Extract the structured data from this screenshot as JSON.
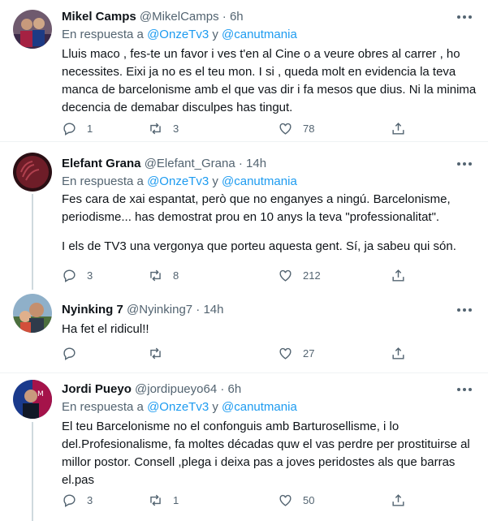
{
  "tweets": [
    {
      "name": "Mikel Camps",
      "handle": "@MikelCamps",
      "separator": "·",
      "time": "6h",
      "reply_prefix": "En respuesta a",
      "mention1": "@OnzeTv3",
      "conjunction": "y",
      "mention2": "@canutmania",
      "text": "Lluis maco , fes-te un favor i ves t'en al Cine o a veure obres al carrer , ho necessites. Eixi ja no es el teu mon. I si , queda molt en evidencia la teva manca de barcelonisme amb el que vas dir i fa mesos que dius. Ni la minima decencia de demabar disculpes has tingut.",
      "replies": "1",
      "retweets": "3",
      "likes": "78"
    },
    {
      "name": "Elefant Grana",
      "handle": "@Elefant_Grana",
      "separator": "·",
      "time": "14h",
      "reply_prefix": "En respuesta a",
      "mention1": "@OnzeTv3",
      "conjunction": "y",
      "mention2": "@canutmania",
      "text": "Fes cara de xai espantat, però que no enganyes a ningú. Barcelonisme, periodisme... has demostrat prou en 10 anys la teva \"professionalitat\".",
      "text2": "I els de TV3 una vergonya que porteu aquesta gent. Sí, ja sabeu qui són.",
      "replies": "3",
      "retweets": "8",
      "likes": "212"
    },
    {
      "name": "Nyinking 7",
      "handle": "@Nyinking7",
      "separator": "·",
      "time": "14h",
      "text": "Ha fet el ridicul!!",
      "replies": "",
      "retweets": "",
      "likes": "27"
    },
    {
      "name": "Jordi Pueyo",
      "handle": "@jordipueyo64",
      "separator": "·",
      "time": "6h",
      "reply_prefix": "En respuesta a",
      "mention1": "@OnzeTv3",
      "conjunction": "y",
      "mention2": "@canutmania",
      "text": "El teu Barcelonisme no el confonguis amb Barturosellisme, i lo del.Profesionalisme, fa moltes décadas quw el vas perdre per prostituirse al millor postor. Consell ,plega i deixa pas a joves peridostes als que barras el.pas",
      "replies": "3",
      "retweets": "1",
      "likes": "50"
    }
  ]
}
